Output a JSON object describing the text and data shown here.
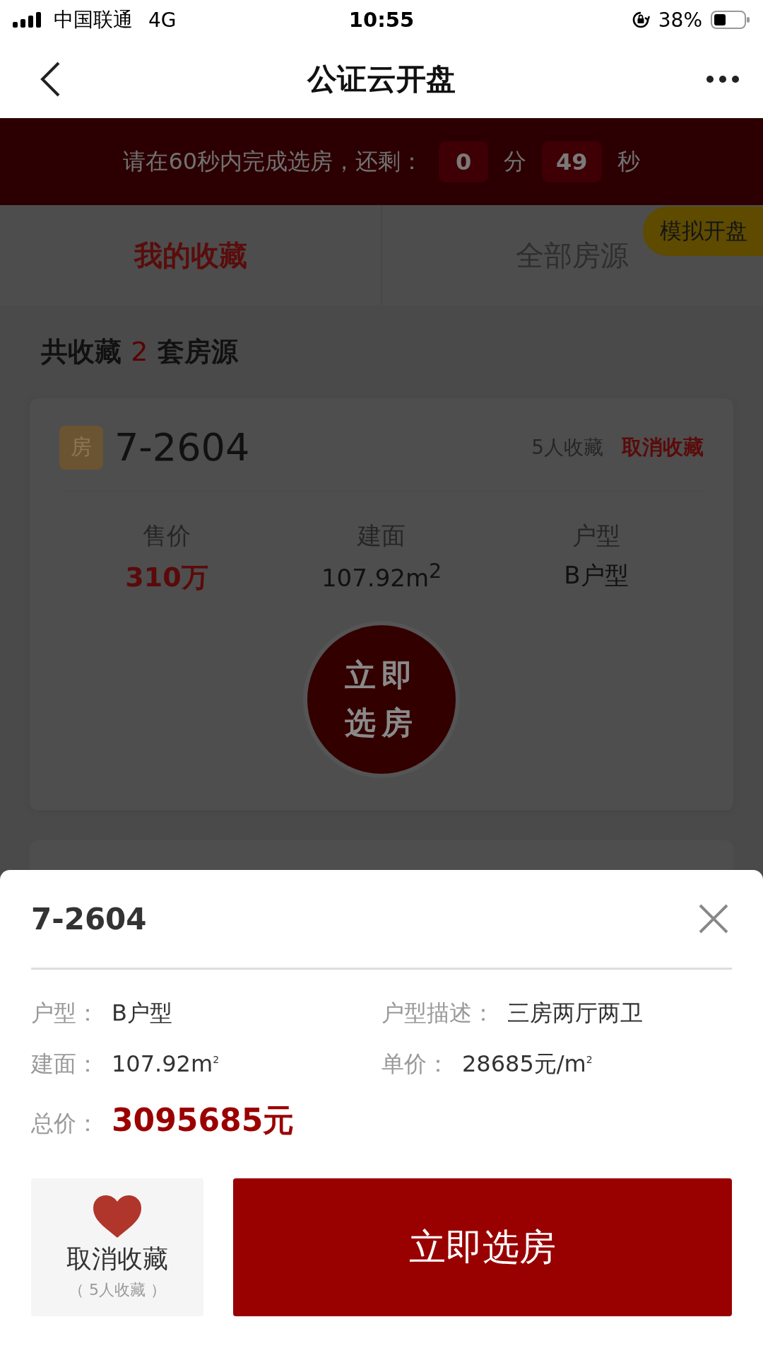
{
  "status_bar": {
    "carrier": "中国联通",
    "network": "4G",
    "time": "10:55",
    "battery": "38%"
  },
  "nav": {
    "title": "公证云开盘"
  },
  "timer": {
    "prompt": "请在60秒内完成选房，还剩：",
    "minutes": "0",
    "minutes_unit": "分",
    "seconds": "49",
    "seconds_unit": "秒"
  },
  "tabs": [
    {
      "label": "我的收藏",
      "selected": true
    },
    {
      "label": "全部房源",
      "selected": false
    }
  ],
  "floating_badge": "模拟开盘",
  "summary": "共收藏 **2** 套房源",
  "cards": [
    {
      "tag": "房",
      "unit": "7-2604",
      "favorites": "5人收藏",
      "action": "取消收藏",
      "stats": [
        {
          "label": "售价",
          "value": "310万",
          "kind": "price"
        },
        {
          "label": "建面",
          "value": "107.92m$^{2}$",
          "kind": "plain"
        },
        {
          "label": "户型",
          "value": "B户型",
          "kind": "plain"
        }
      ],
      "button": [
        "立即",
        "选房"
      ]
    }
  ],
  "sheet": {
    "title": "7-2604",
    "details": [
      {
        "label": "户型：",
        "value": "B户型",
        "kind": "plain"
      },
      {
        "label": "户型描述：",
        "value": "三房两厅两卫",
        "kind": "plain"
      },
      {
        "label": "建面：",
        "value": "107.92m$^{2}$",
        "kind": "plain"
      },
      {
        "label": "单价：",
        "value": "28685元/m$^{2}$",
        "kind": "plain"
      },
      {
        "label": "总价：",
        "value": "3095685元",
        "kind": "total"
      }
    ],
    "favorite_button": {
      "label": "取消收藏",
      "count": "（ 5人收藏 ）"
    },
    "primary_button": "立即选房"
  }
}
